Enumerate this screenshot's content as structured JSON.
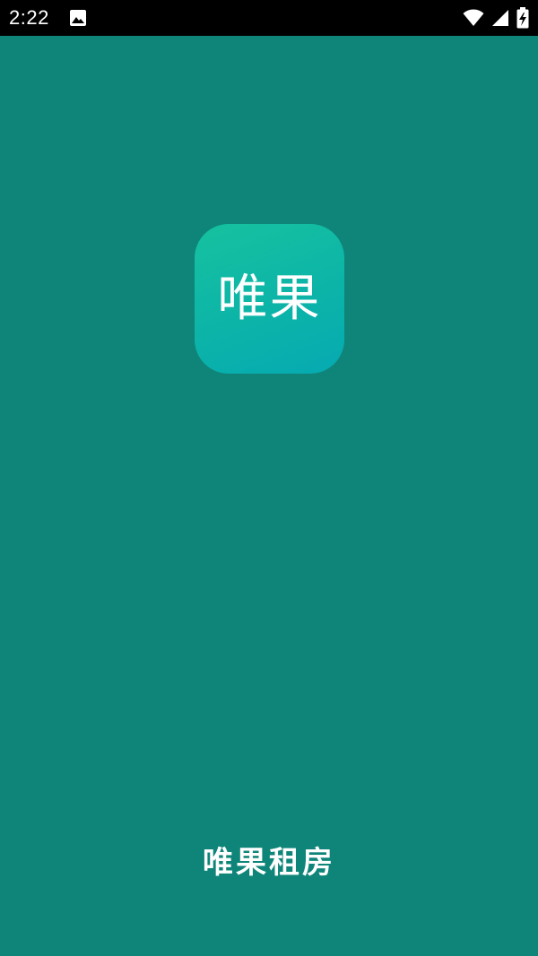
{
  "status_bar": {
    "time": "2:22",
    "icons": [
      "image-icon",
      "wifi-icon",
      "cellular-signal-icon",
      "battery-charging-icon"
    ]
  },
  "splash": {
    "logo_text": "唯果",
    "app_name": "唯果租房"
  },
  "colors": {
    "background": "#0f8579",
    "status_bar": "#000000",
    "logo_gradient_start": "#16c29f",
    "logo_gradient_end": "#06aab2",
    "text": "#ffffff"
  }
}
